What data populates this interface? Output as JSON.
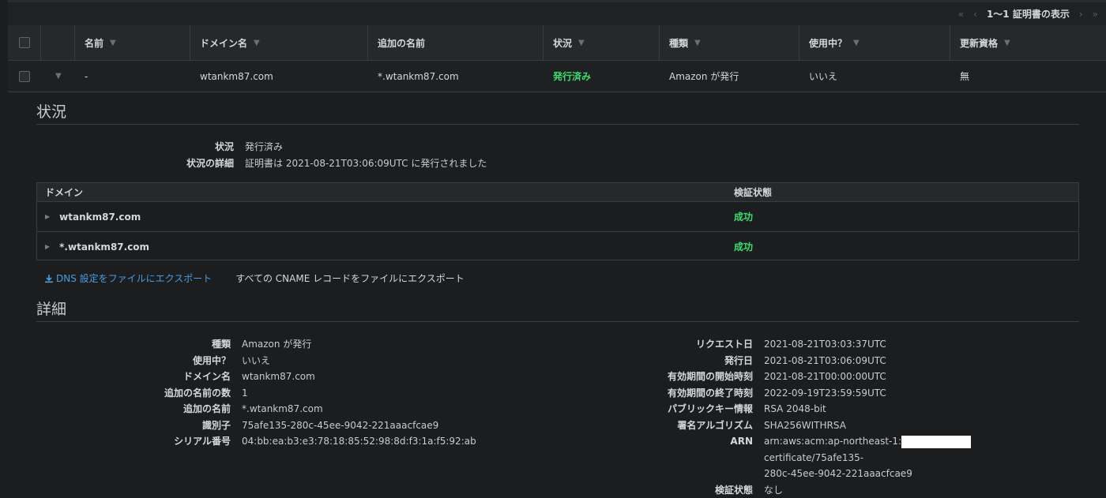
{
  "pager": {
    "first": "«",
    "prev": "‹",
    "count_label": "1〜1 証明書の表示",
    "next": "›",
    "last": "»"
  },
  "table": {
    "headers": [
      "名前",
      "ドメイン名",
      "追加の名前",
      "状況",
      "種類",
      "使用中？",
      "更新資格"
    ],
    "row": {
      "name": "-",
      "domain": "wtankm87.com",
      "additional": "*.wtankm87.com",
      "status": "発行済み",
      "type": "Amazon が発行",
      "in_use": "いいえ",
      "renewal": "無"
    }
  },
  "status_section": {
    "title": "状況",
    "status_label": "状況",
    "status_value": "発行済み",
    "detail_label": "状況の詳細",
    "detail_value": "証明書は 2021-08-21T03:06:09UTC に発行されました"
  },
  "domain_table": {
    "col_domain": "ドメイン",
    "col_validation": "検証状態",
    "rows": [
      {
        "domain": "wtankm87.com",
        "validation": "成功"
      },
      {
        "domain": "*.wtankm87.com",
        "validation": "成功"
      }
    ]
  },
  "exports": {
    "dns": "DNS 設定をファイルにエクスポート",
    "cname": "すべての CNAME レコードをファイルにエクスポート"
  },
  "details": {
    "title": "詳細",
    "left": [
      {
        "k": "種類",
        "v": "Amazon が発行"
      },
      {
        "k": "使用中？",
        "v": "いいえ"
      },
      {
        "k": "ドメイン名",
        "v": "wtankm87.com"
      },
      {
        "k": "追加の名前の数",
        "v": "1"
      },
      {
        "k": "追加の名前",
        "v": "*.wtankm87.com"
      },
      {
        "k": "識別子",
        "v": "75afe135-280c-45ee-9042-221aaacfcae9"
      },
      {
        "k": "シリアル番号",
        "v": "04:bb:ea:b3:e3:78:18:85:52:98:8d:f3:1a:f5:92:ab"
      }
    ],
    "right": [
      {
        "k": "リクエスト日",
        "v": "2021-08-21T03:03:37UTC"
      },
      {
        "k": "発行日",
        "v": "2021-08-21T03:06:09UTC"
      },
      {
        "k": "有効期間の開始時刻",
        "v": "2021-08-21T00:00:00UTC"
      },
      {
        "k": "有効期間の終了時刻",
        "v": "2022-09-19T23:59:59UTC"
      },
      {
        "k": "パブリックキー情報",
        "v": "RSA 2048-bit"
      },
      {
        "k": "署名アルゴリズム",
        "v": "SHA256WITHRSA"
      }
    ],
    "arn_label": "ARN",
    "arn_prefix": "arn:aws:acm:ap-northeast-1:",
    "arn_suffix": "certificate/75afe135-",
    "arn_line2": "280c-45ee-9042-221aaacfcae9",
    "validation_label": "検証状態",
    "validation_value": "なし"
  }
}
